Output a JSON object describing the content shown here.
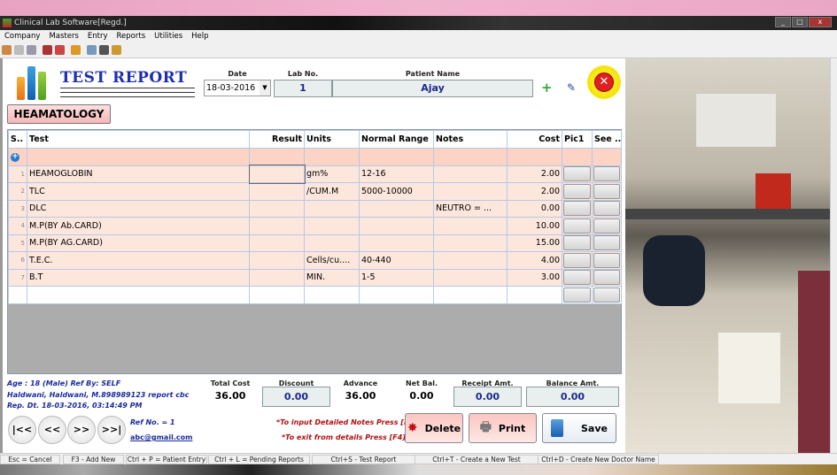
{
  "window": {
    "title": "Clinical Lab Software[Regd.]"
  },
  "menu": [
    "Company",
    "Masters",
    "Entry",
    "Reports",
    "Utilities",
    "Help"
  ],
  "header": {
    "title": "TEST REPORT",
    "date_label": "Date",
    "date_value": "18-03-2016",
    "labno_label": "Lab No.",
    "labno_value": "1",
    "patient_label": "Patient Name",
    "patient_value": "Ajay",
    "department": "HEAMATOLOGY"
  },
  "grid": {
    "columns": [
      "S..",
      "Test",
      "Result",
      "Units",
      "Normal Range",
      "Notes",
      "Cost",
      "Pic1",
      "See .."
    ],
    "rows": [
      {
        "s": "1",
        "test": "HEAMOGLOBIN",
        "result": "",
        "units": "gm%",
        "range": "12-16",
        "notes": "",
        "cost": "2.00"
      },
      {
        "s": "2",
        "test": "TLC",
        "result": "",
        "units": "/CUM.M",
        "range": "5000-10000",
        "notes": "",
        "cost": "2.00"
      },
      {
        "s": "3",
        "test": "DLC",
        "result": "",
        "units": "",
        "range": "",
        "notes": "NEUTRO =   ...",
        "cost": "0.00"
      },
      {
        "s": "4",
        "test": "M.P(BY Ab.CARD)",
        "result": "",
        "units": "",
        "range": "",
        "notes": "",
        "cost": "10.00"
      },
      {
        "s": "5",
        "test": "M.P(BY AG.CARD)",
        "result": "",
        "units": "",
        "range": "",
        "notes": "",
        "cost": "15.00"
      },
      {
        "s": "6",
        "test": "T.E.C.",
        "result": "",
        "units": "Cells/cu....",
        "range": "40-440",
        "notes": "",
        "cost": "4.00"
      },
      {
        "s": "7",
        "test": "B.T",
        "result": "",
        "units": "MIN.",
        "range": "1-5",
        "notes": "",
        "cost": "3.00"
      }
    ]
  },
  "info": {
    "line1": "Age : 18 (Male) Ref By: SELF",
    "line2": "Haldwani, Haldwani, M.898989123  report cbc",
    "line3": "Rep. Dt. 18-03-2016, 03:14:49 PM",
    "ref": "Ref No. = 1",
    "email": "abc@gmail.com"
  },
  "summary": {
    "total_label": "Total Cost",
    "total": "36.00",
    "discount_label": "Discount",
    "discount": "0.00",
    "advance_label": "Advance",
    "advance": "36.00",
    "netbal_label": "Net Bal.",
    "netbal": "0.00",
    "receipt_label": "Receipt Amt.",
    "receipt": "0.00",
    "balance_label": "Balance Amt.",
    "balance": "0.00"
  },
  "nav": {
    "first": "|<<",
    "prev": "<<",
    "next": ">>",
    "last": ">>|"
  },
  "hints": {
    "h1": "*To input Detailed Notes Press [F4]",
    "h2": "*To exit from details Press [F4]"
  },
  "buttons": {
    "delete": "Delete",
    "print": "Print",
    "save": "Save"
  },
  "status": [
    "Esc = Cancel",
    "F3 - Add New",
    "Ctrl + P = Patient Entry",
    "Ctrl + L = Pending Reports",
    "Ctrl+S - Test Report",
    "Ctrl+T  -  Create a New Test",
    "Ctrl+D - Create New Doctor Name"
  ],
  "colors": {
    "title": "#1d2fb0",
    "row": "#fde6dc",
    "add_row": "#fcd3c5",
    "close": "#e02020"
  }
}
